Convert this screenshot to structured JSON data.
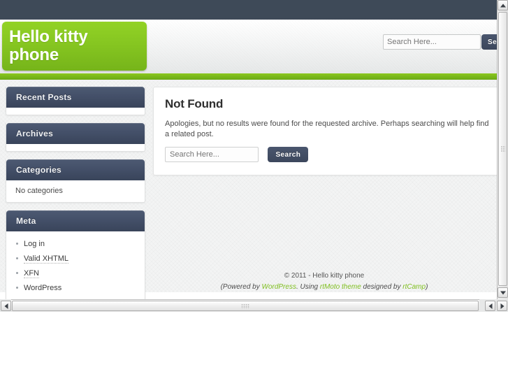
{
  "site": {
    "title": "Hello kitty phone"
  },
  "header": {
    "search": {
      "placeholder": "Search Here...",
      "value": "",
      "button_label": "Search"
    }
  },
  "sidebar": {
    "widgets": [
      {
        "title": "Recent Posts",
        "body_text": "",
        "items": []
      },
      {
        "title": "Archives",
        "body_text": "",
        "items": []
      },
      {
        "title": "Categories",
        "body_text": "No categories",
        "items": []
      },
      {
        "title": "Meta",
        "body_text": "",
        "items": [
          {
            "label": "Log in",
            "dotted": false
          },
          {
            "label": "Valid XHTML",
            "dotted": true
          },
          {
            "label": "XFN",
            "dotted": true
          },
          {
            "label": "WordPress",
            "dotted": false
          }
        ]
      }
    ]
  },
  "main": {
    "heading": "Not Found",
    "body": "Apologies, but no results were found for the requested archive. Perhaps searching will help find a related post.",
    "search": {
      "placeholder": "Search Here...",
      "value": "",
      "button_label": "Search"
    }
  },
  "footer": {
    "copyright": "© 2011 - Hello kitty phone",
    "credits_prefix": "(Powered by ",
    "credits_link1": "WordPress",
    "credits_mid1": ". Using ",
    "credits_link2": "rtMoto theme",
    "credits_mid2": " designed by ",
    "credits_link3": "rtCamp",
    "credits_suffix": ")"
  },
  "colors": {
    "accent_green": "#86c621",
    "dark_navy": "#3e4a58",
    "widget_header": "#45516a",
    "link_green": "#7fbf1f"
  },
  "scrollbars": {
    "up_arrow": "arrow-up-icon",
    "down_arrow": "arrow-down-icon",
    "left_arrow": "arrow-left-icon",
    "right_arrow": "arrow-right-icon"
  }
}
